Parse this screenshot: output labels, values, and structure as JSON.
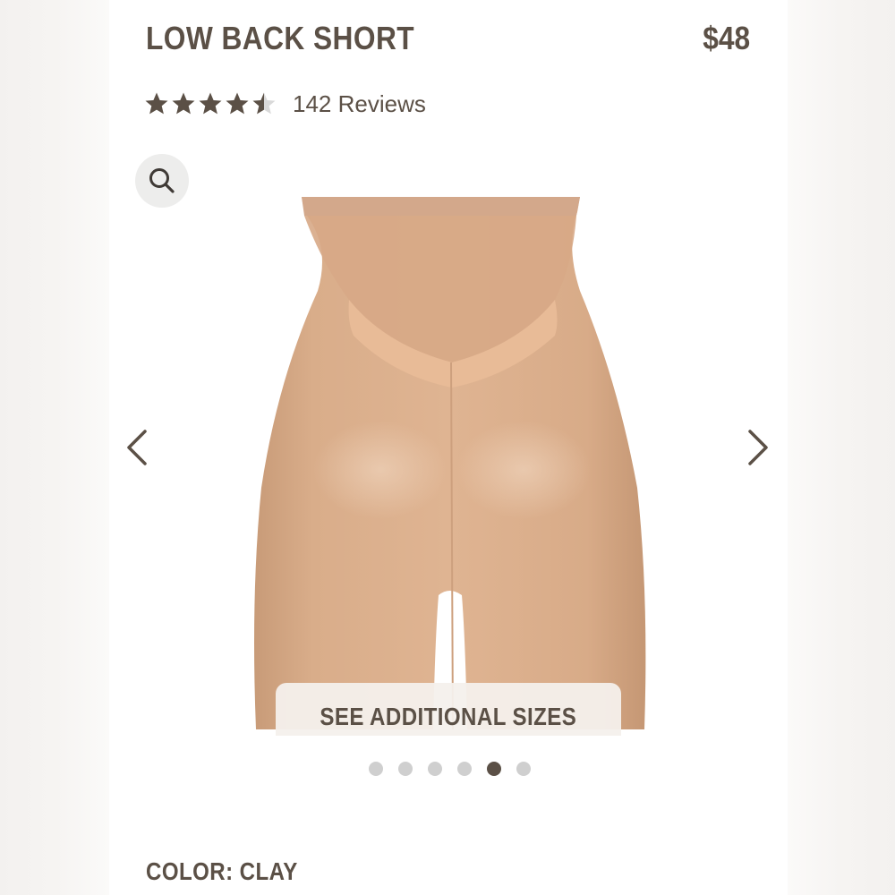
{
  "product": {
    "title": "LOW BACK SHORT",
    "price": "$48",
    "rating_value": 4.5,
    "rating_max": 5,
    "reviews_label": "142 Reviews",
    "color_line": "COLOR: CLAY"
  },
  "gallery": {
    "see_sizes_label": "SEE ADDITIONAL SIZES",
    "dot_count": 6,
    "active_index": 4,
    "icons": {
      "zoom": "search-icon",
      "prev": "chevron-left-icon",
      "next": "chevron-right-icon"
    }
  },
  "colors": {
    "text": "#5b5046",
    "star_empty": "#d9d9d9",
    "dot_inactive": "#cfcfcf",
    "dot_active": "#5b5046",
    "garment": "#d9ab87"
  }
}
